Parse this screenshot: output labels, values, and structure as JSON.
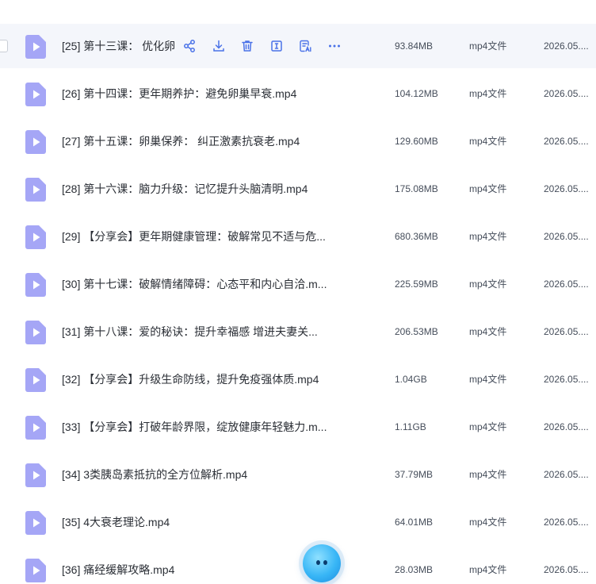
{
  "rows": [
    {
      "name": "[25] 第十三课：  优化卵",
      "size": "93.84MB",
      "type": "mp4文件",
      "date": "2026.05...."
    },
    {
      "name": "[26] 第十四课：更年期养护：避免卵巢早衰.mp4",
      "size": "104.12MB",
      "type": "mp4文件",
      "date": "2026.05...."
    },
    {
      "name": "[27] 第十五课：卵巢保养：  纠正激素抗衰老.mp4",
      "size": "129.60MB",
      "type": "mp4文件",
      "date": "2026.05...."
    },
    {
      "name": "[28] 第十六课：脑力升级：记忆提升头脑清明.mp4",
      "size": "175.08MB",
      "type": "mp4文件",
      "date": "2026.05...."
    },
    {
      "name": "[29] 【分享会】更年期健康管理：破解常见不适与危...",
      "size": "680.36MB",
      "type": "mp4文件",
      "date": "2026.05...."
    },
    {
      "name": "[30] 第十七课：破解情绪障碍：心态平和内心自洽.m...",
      "size": "225.59MB",
      "type": "mp4文件",
      "date": "2026.05...."
    },
    {
      "name": "[31] 第十八课：爱的秘诀：提升幸福感 增进夫妻关...",
      "size": "206.53MB",
      "type": "mp4文件",
      "date": "2026.05...."
    },
    {
      "name": "[32] 【分享会】升级生命防线，提升免疫强体质.mp4",
      "size": "1.04GB",
      "type": "mp4文件",
      "date": "2026.05...."
    },
    {
      "name": "[33] 【分享会】打破年龄界限，绽放健康年轻魅力.m...",
      "size": "1.11GB",
      "type": "mp4文件",
      "date": "2026.05...."
    },
    {
      "name": "[34] 3类胰岛素抵抗的全方位解析.mp4",
      "size": "37.79MB",
      "type": "mp4文件",
      "date": "2026.05...."
    },
    {
      "name": "[35] 4大衰老理论.mp4",
      "size": "64.01MB",
      "type": "mp4文件",
      "date": "2026.05...."
    },
    {
      "name": "[36] 痛经缓解攻略.mp4",
      "size": "28.03MB",
      "type": "mp4文件",
      "date": "2026.05...."
    }
  ],
  "row_actions": [
    "share-icon",
    "download-icon",
    "delete-icon",
    "rename-icon",
    "ai-summary-icon",
    "more-icon"
  ],
  "colors": {
    "file_icon": "#a5a6f6",
    "action_icon": "#4a72e8",
    "hover_row": "#f4f6fb"
  }
}
